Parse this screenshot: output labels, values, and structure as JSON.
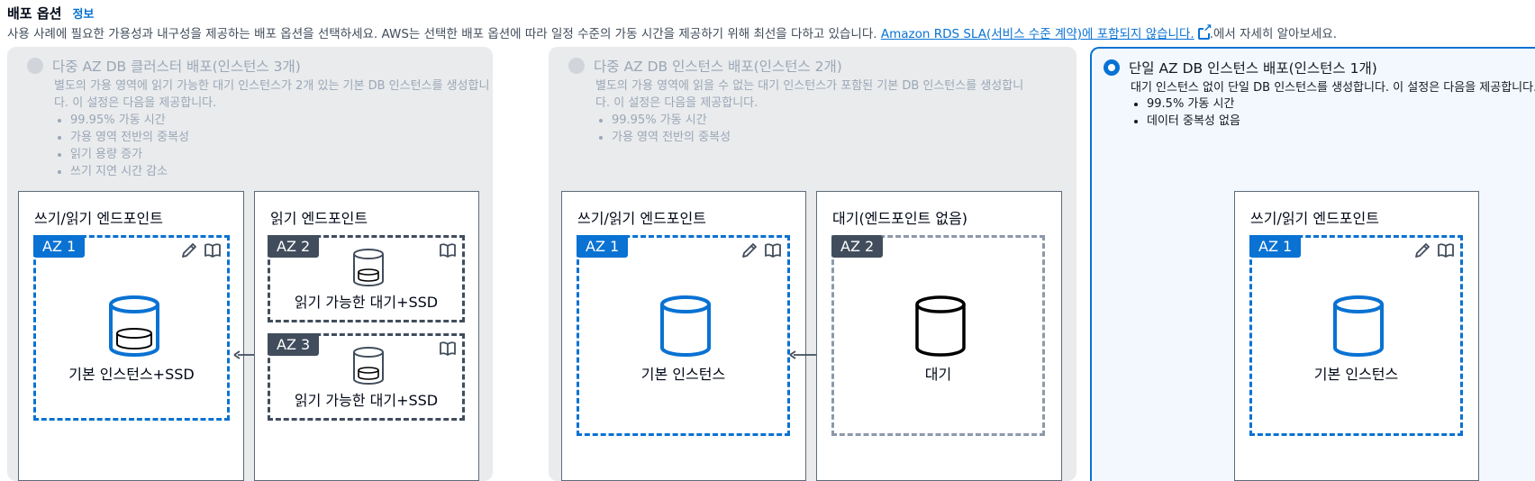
{
  "header": {
    "title": "배포 옵션",
    "info": "정보"
  },
  "description": {
    "text": "사용 사례에 필요한 가용성과 내구성을 제공하는 배포 옵션을 선택하세요. AWS는 선택한 배포 옵션에 따라 일정 수준의 가동 시간을 제공하기 위해 최선을 다하고 있습니다. ",
    "link": "Amazon RDS SLA(서비스 수준 계약)에 포함되지 않습니다.",
    "suffix": ".에서 자세히 알아보세요."
  },
  "colors": {
    "accent": "#0972d3",
    "disabled_bg": "#e9ebed",
    "selected_bg": "#f2f8fd"
  },
  "options": [
    {
      "title": "다중 AZ DB 클러스터 배포(인스턴스 3개)",
      "sub_line1": "별도의 가용 영역에 읽기 가능한 대기 인스턴스가 2개 있는 기본 DB 인스턴스를 생성합니",
      "sub_line2": "다. 이 설정은 다음을 제공합니다.",
      "bullets": [
        "99.95% 가동 시간",
        "가용 영역 전반의 중복성",
        "읽기 용량 증가",
        "쓰기 지연 시간 감소"
      ],
      "selected": false,
      "diagram": {
        "left_box": "쓰기/읽기 엔드포인트",
        "right_box": "읽기 엔드포인트",
        "az_primary": "AZ 1",
        "primary_caption": "기본 인스턴스+SSD",
        "az_read_1": "AZ 2",
        "read_1_caption": "읽기 가능한 대기+SSD",
        "az_read_2": "AZ 3",
        "read_2_caption": "읽기 가능한 대기+SSD"
      }
    },
    {
      "title": "다중 AZ DB 인스턴스 배포(인스턴스 2개)",
      "sub_line1": "별도의 가용 영역에 읽을 수 없는 대기 인스턴스가 포함된 기본 DB 인스턴스를 생성합니",
      "sub_line2": "다. 이 설정은 다음을 제공합니다.",
      "bullets": [
        "99.95% 가동 시간",
        "가용 영역 전반의 중복성"
      ],
      "selected": false,
      "diagram": {
        "left_box": "쓰기/읽기 엔드포인트",
        "right_box": "대기(엔드포인트 없음)",
        "az_primary": "AZ 1",
        "primary_caption": "기본 인스턴스",
        "az_standby": "AZ 2",
        "standby_caption": "대기"
      }
    },
    {
      "title": "단일 AZ DB 인스턴스 배포(인스턴스 1개)",
      "sub_line1": "대기 인스턴스 없이 단일 DB 인스턴스를 생성합니다. 이 설정은 다음을 제공합니다.",
      "bullets": [
        "99.5% 가동 시간",
        "데이터 중복성 없음"
      ],
      "selected": true,
      "diagram": {
        "box": "쓰기/읽기 엔드포인트",
        "az_primary": "AZ 1",
        "primary_caption": "기본 인스턴스"
      }
    }
  ]
}
